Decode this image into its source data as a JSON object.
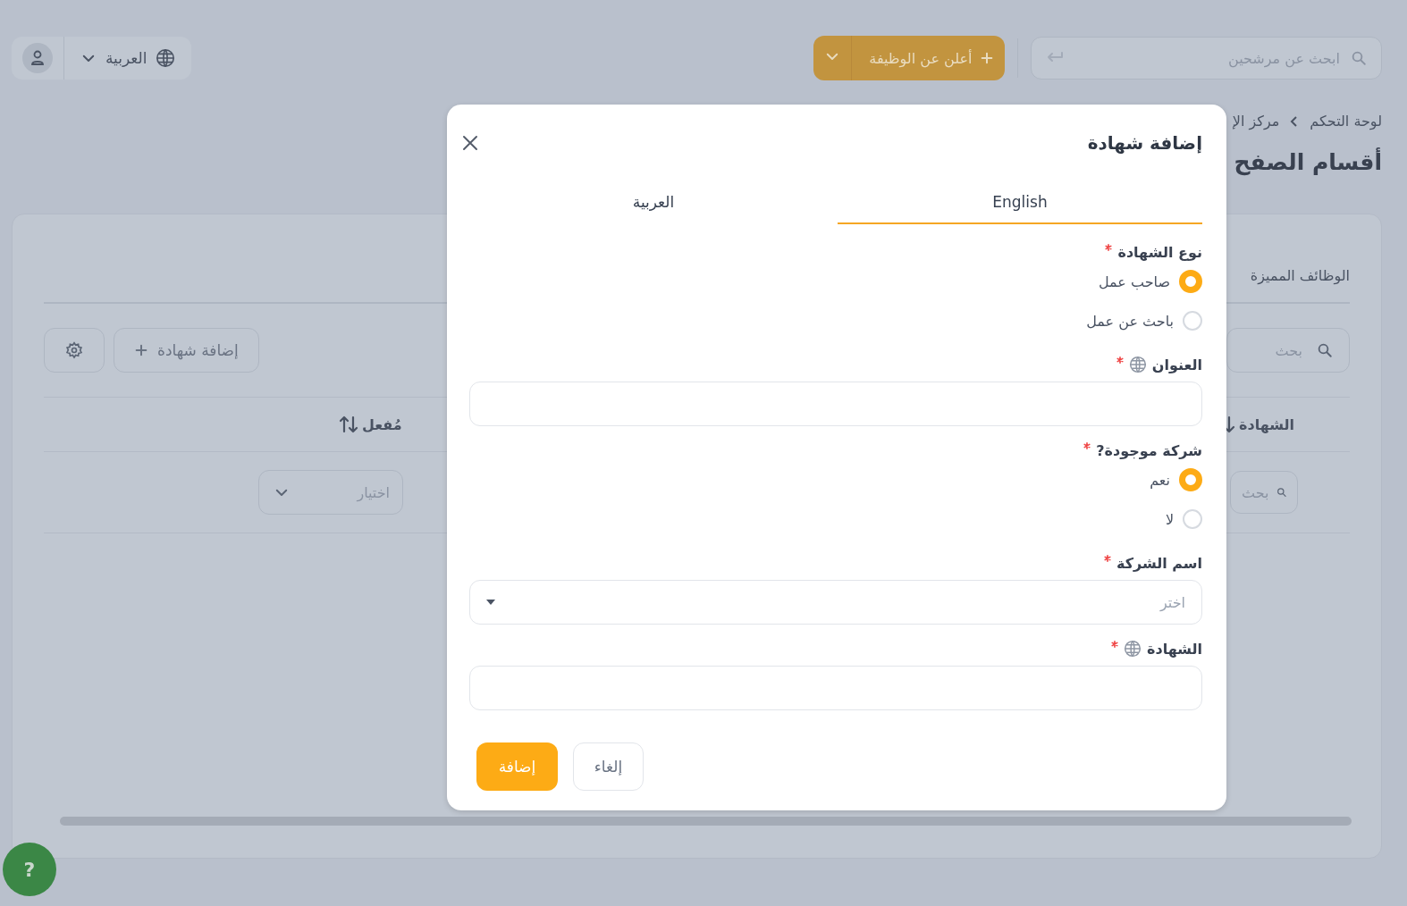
{
  "header": {
    "candidate_search": {
      "placeholder": "ابحث عن مرشحين"
    },
    "post_job_button": "أعلن عن الوظيفة",
    "language": "العربية"
  },
  "breadcrumb": [
    "لوحة التحكم",
    "مركز الإ"
  ],
  "page_title": "أقسام الصفح",
  "card": {
    "tab_label": "الوظائف المميزة",
    "search": {
      "placeholder": "بحث"
    },
    "add_button": "إضافة شهادة",
    "columns": [
      {
        "label": "الشهادة",
        "sorted": true
      },
      {
        "label": "مُفعل",
        "sorted": false
      }
    ],
    "filters": [
      {
        "kind": "search",
        "placeholder": "بحث"
      },
      {
        "kind": "select",
        "placeholder": "اختيار"
      }
    ]
  },
  "modal": {
    "title": "إضافة شهادة",
    "tabs": [
      {
        "label": "English",
        "selected": true
      },
      {
        "label": "العربية",
        "selected": false
      }
    ],
    "fields": [
      {
        "kind": "radio",
        "label": "نوع الشهادة",
        "required": true,
        "options": [
          {
            "label": "صاحب عمل",
            "selected": true
          },
          {
            "label": "باحث عن عمل",
            "selected": false
          }
        ]
      },
      {
        "kind": "text",
        "label": "العنوان",
        "required": true,
        "translatable": true
      },
      {
        "kind": "radio",
        "label": "شركة موجودة?",
        "required": true,
        "options": [
          {
            "label": "نعم",
            "selected": true
          },
          {
            "label": "لا",
            "selected": false
          }
        ]
      },
      {
        "kind": "select",
        "label": "اسم الشركة",
        "required": true,
        "placeholder": "اختر"
      },
      {
        "kind": "text",
        "label": "الشهادة",
        "required": true,
        "translatable": true
      }
    ],
    "buttons": [
      {
        "label": "إلغاء",
        "kind": "secondary"
      },
      {
        "label": "إضافة",
        "kind": "primary"
      }
    ]
  },
  "help_button": "?"
}
